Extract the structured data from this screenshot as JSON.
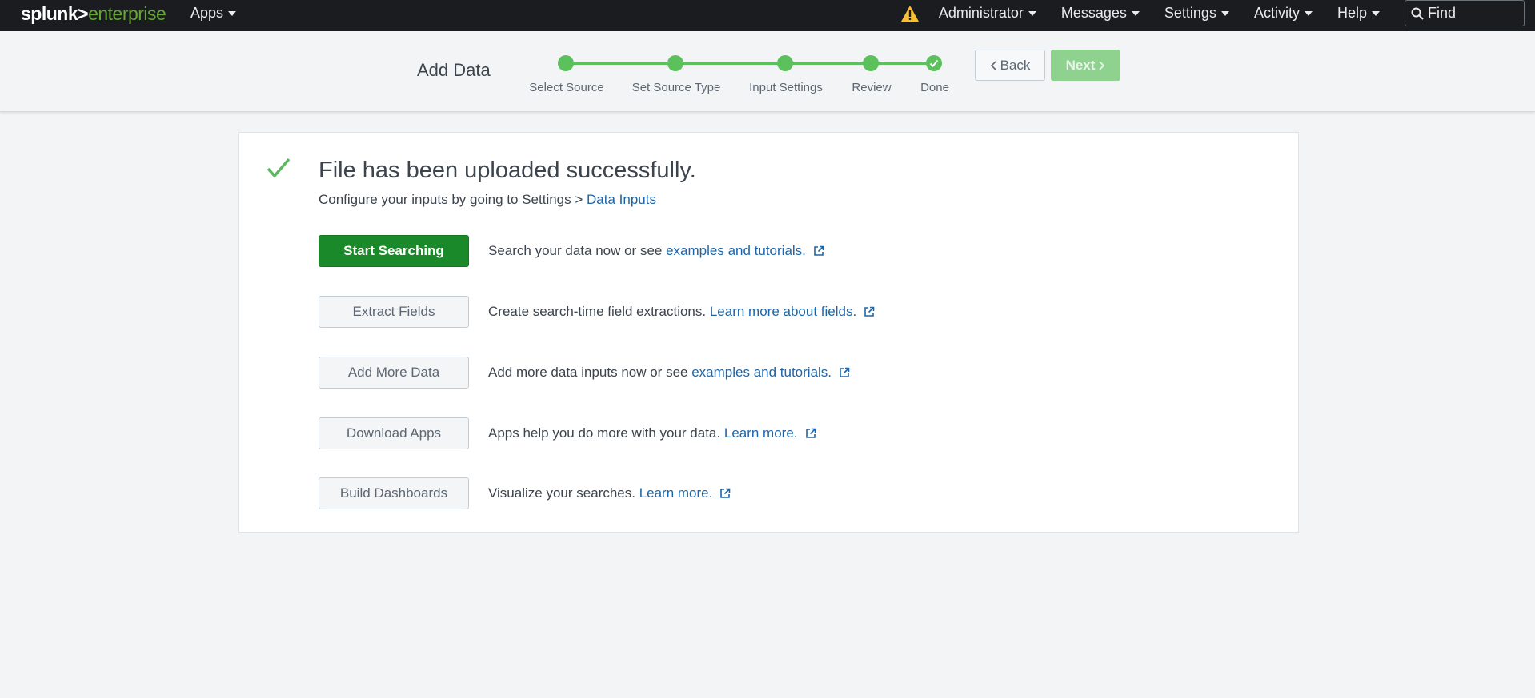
{
  "topbar": {
    "logo_left": "splunk>",
    "logo_right": "enterprise",
    "apps": "Apps",
    "warning_icon": "warning-icon",
    "menu": [
      {
        "label": "Administrator"
      },
      {
        "label": "Messages"
      },
      {
        "label": "Settings"
      },
      {
        "label": "Activity"
      },
      {
        "label": "Help"
      }
    ],
    "search_placeholder": "Find"
  },
  "wizard": {
    "title": "Add Data",
    "steps": [
      {
        "label": "Select Source"
      },
      {
        "label": "Set Source Type"
      },
      {
        "label": "Input Settings"
      },
      {
        "label": "Review"
      },
      {
        "label": "Done"
      }
    ],
    "back_label": "Back",
    "next_label": "Next"
  },
  "main": {
    "headline": "File has been uploaded successfully.",
    "subline_text": "Configure your inputs by going to Settings > ",
    "subline_link": "Data Inputs",
    "actions": [
      {
        "button": "Start Searching",
        "text": "Search your data now or see ",
        "link": "examples and tutorials."
      },
      {
        "button": "Extract Fields",
        "text": "Create search-time field extractions. ",
        "link": "Learn more about fields."
      },
      {
        "button": "Add More Data",
        "text": "Add more data inputs now or see ",
        "link": "examples and tutorials."
      },
      {
        "button": "Download Apps",
        "text": "Apps help you do more with your data. ",
        "link": "Learn more."
      },
      {
        "button": "Build Dashboards",
        "text": "Visualize your searches. ",
        "link": "Learn more."
      }
    ]
  },
  "colors": {
    "topbar_bg": "#1a1c20",
    "accent_green": "#5cc05c",
    "primary_button": "#1a8929",
    "link": "#1e65a6",
    "warning": "#f8be34"
  }
}
